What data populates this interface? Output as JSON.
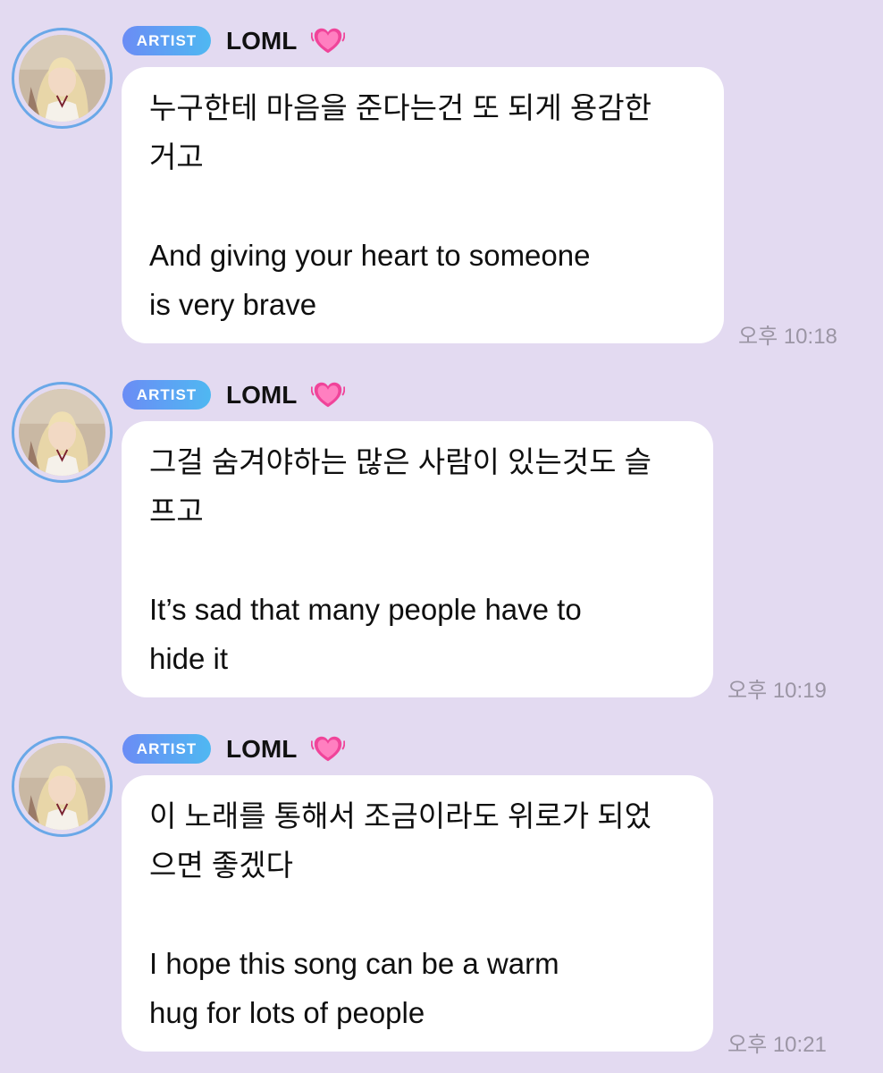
{
  "chat": {
    "messages": [
      {
        "badge": "ARTIST",
        "sender": "LOML",
        "heart_icon": "heart-emoji-icon",
        "korean": "누구한테 마음을 준다는건 또 되게 용감한\n거고",
        "english": "And giving your heart to someone\nis very brave",
        "time": "오후 10:18"
      },
      {
        "badge": "ARTIST",
        "sender": "LOML",
        "heart_icon": "heart-emoji-icon",
        "korean": "그걸 숨겨야하는 많은 사람이 있는것도 슬\n프고",
        "english": "It’s sad that many people have to\nhide it",
        "time": "오후 10:19"
      },
      {
        "badge": "ARTIST",
        "sender": "LOML",
        "heart_icon": "heart-emoji-icon",
        "korean": "이 노래를 통해서 조금이라도 위로가 되었\n으면 좋겠다",
        "english": "I hope this song can be a warm\nhug for lots of people",
        "time": "오후 10:21"
      }
    ]
  },
  "colors": {
    "background": "#e3daf1",
    "bubble": "#ffffff",
    "badge_start": "#6b8cf5",
    "badge_end": "#4fb8f2",
    "avatar_ring": "#6aa8e8",
    "timestamp": "#9b95a4",
    "heart": "#f0449a"
  }
}
